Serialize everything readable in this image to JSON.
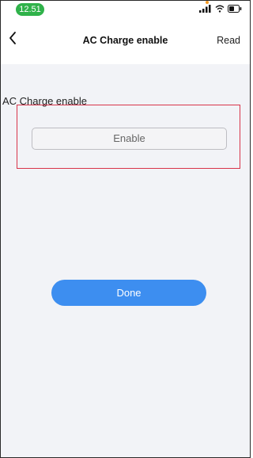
{
  "status_bar": {
    "time": "12.51",
    "icons": [
      "signal-icon",
      "wifi-icon",
      "battery-icon"
    ],
    "time_color": "#2fb24a"
  },
  "nav": {
    "back_icon": "chevron-left-icon",
    "title": "AC Charge enable",
    "right_action": "Read"
  },
  "main": {
    "section_label": "AC Charge enable",
    "field_value": "Enable",
    "done_label": "Done"
  },
  "colors": {
    "accent": "#3d8ef0",
    "highlight_box": "#d8344a",
    "background": "#f2f3f7"
  }
}
